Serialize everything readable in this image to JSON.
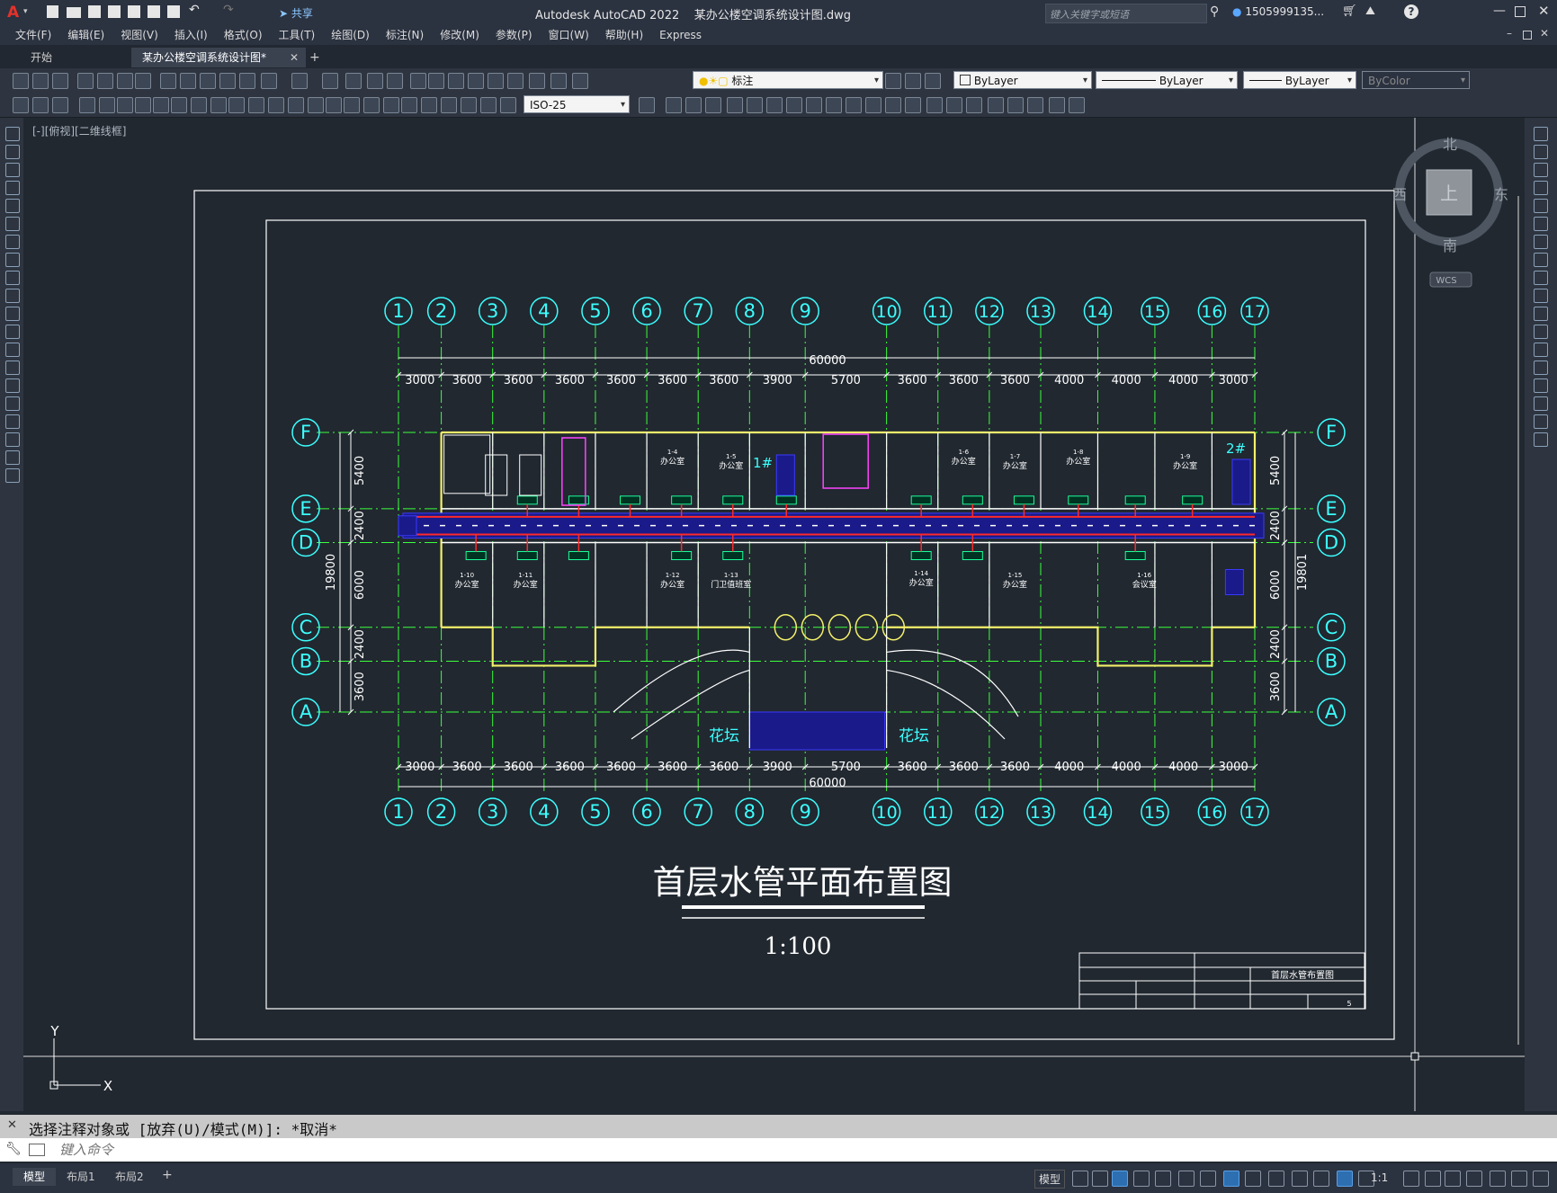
{
  "app": {
    "title": "Autodesk AutoCAD 2022    某办公楼空调系统设计图.dwg",
    "share_label": "共享",
    "search_placeholder": "键入关键字或短语",
    "user": "1505999135...",
    "help_icon": "?"
  },
  "menu": [
    "文件(F)",
    "编辑(E)",
    "视图(V)",
    "插入(I)",
    "格式(O)",
    "工具(T)",
    "绘图(D)",
    "标注(N)",
    "修改(M)",
    "参数(P)",
    "窗口(W)",
    "帮助(H)",
    "Express"
  ],
  "tabs": {
    "start": "开始",
    "active": "某办公楼空调系统设计图*",
    "add": "+"
  },
  "properties": {
    "layer": "标注",
    "color": "ByLayer",
    "linetype": "ByLayer",
    "lineweight": "ByLayer",
    "plotstyle": "ByColor",
    "dimstyle": "ISO-25"
  },
  "viewport_label": "[-][俯视][二维线框]",
  "viewcube": {
    "north": "北",
    "south": "南",
    "east": "东",
    "west": "西",
    "top": "上",
    "wcs": "WCS"
  },
  "drawing": {
    "title": "首层水管平面布置图",
    "scale": "1:100",
    "titleblock_name": "首层水管布置图",
    "sheet_no": "5",
    "axis_numbers": [
      "1",
      "2",
      "3",
      "4",
      "5",
      "6",
      "7",
      "8",
      "9",
      "10",
      "11",
      "12",
      "13",
      "14",
      "15",
      "16",
      "17"
    ],
    "axis_letters": [
      "F",
      "E",
      "D",
      "C",
      "B",
      "A"
    ],
    "top_dims": [
      "3000",
      "3600",
      "3600",
      "3600",
      "3600",
      "3600",
      "3600",
      "3900",
      "5700",
      "3600",
      "3600",
      "3600",
      "4000",
      "4000",
      "4000",
      "3000"
    ],
    "total_dim": "60000",
    "left_dims": [
      "5400",
      "2400",
      "6000",
      "2400",
      "3600"
    ],
    "left_total": "19800",
    "right_dims": [
      "5400",
      "2400",
      "6000",
      "2400",
      "3600"
    ],
    "right_total": "19801",
    "rooms": [
      {
        "id": "1-4",
        "name": "办公室"
      },
      {
        "id": "1-5",
        "name": "办公室"
      },
      {
        "id": "1-6",
        "name": "办公室"
      },
      {
        "id": "1-7",
        "name": "办公室"
      },
      {
        "id": "1-8",
        "name": "办公室"
      },
      {
        "id": "1-9",
        "name": "办公室"
      },
      {
        "id": "1-10",
        "name": "办公室"
      },
      {
        "id": "1-11",
        "name": "办公室"
      },
      {
        "id": "1-12",
        "name": "办公室"
      },
      {
        "id": "1-13",
        "name": "门卫值班室"
      },
      {
        "id": "1-14",
        "name": "办公室"
      },
      {
        "id": "1-15",
        "name": "办公室"
      },
      {
        "id": "1-16",
        "name": "会议室"
      }
    ],
    "stairs": [
      "1#",
      "2#"
    ],
    "flowerbeds": [
      "花坛",
      "花坛"
    ]
  },
  "ucs": {
    "x": "X",
    "y": "Y"
  },
  "command": {
    "history": "选择注释对象或 [放弃(U)/模式(M)]: *取消*",
    "placeholder": "键入命令"
  },
  "status": {
    "layout_tabs": [
      "模型",
      "布局1",
      "布局2"
    ],
    "model": "模型",
    "scale": "1:1"
  }
}
